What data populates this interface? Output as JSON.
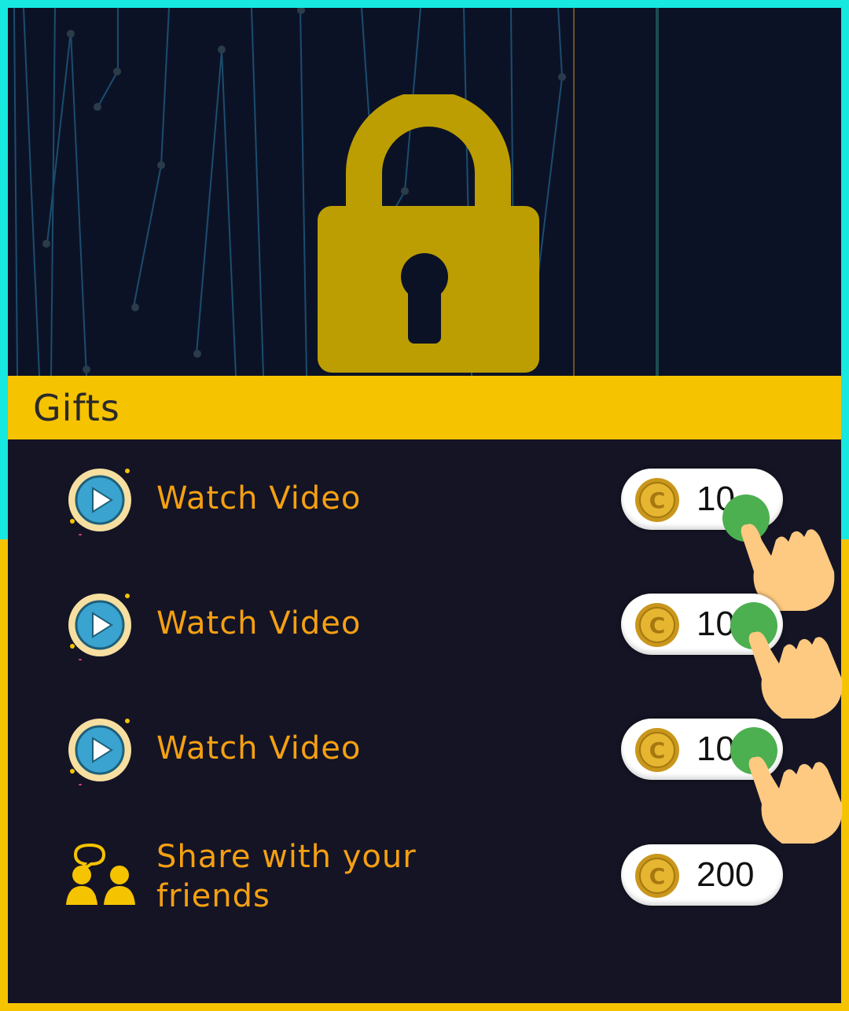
{
  "header": {
    "title": "Gifts"
  },
  "rewards": [
    {
      "label": "Watch Video",
      "amount": "10",
      "icon": "play-video-icon"
    },
    {
      "label": "Watch Video",
      "amount": "10",
      "icon": "play-video-icon"
    },
    {
      "label": "Watch Video",
      "amount": "10",
      "icon": "play-video-icon"
    },
    {
      "label_line1": "Share with your",
      "label_line2": "friends",
      "amount": "200",
      "icon": "share-friends-icon"
    }
  ],
  "colors": {
    "accent_yellow": "#f5c300",
    "label_orange": "#f5a012",
    "panel_bg": "#141425",
    "frame_cyan": "#17e8e0",
    "tap_green": "#4caf50"
  }
}
